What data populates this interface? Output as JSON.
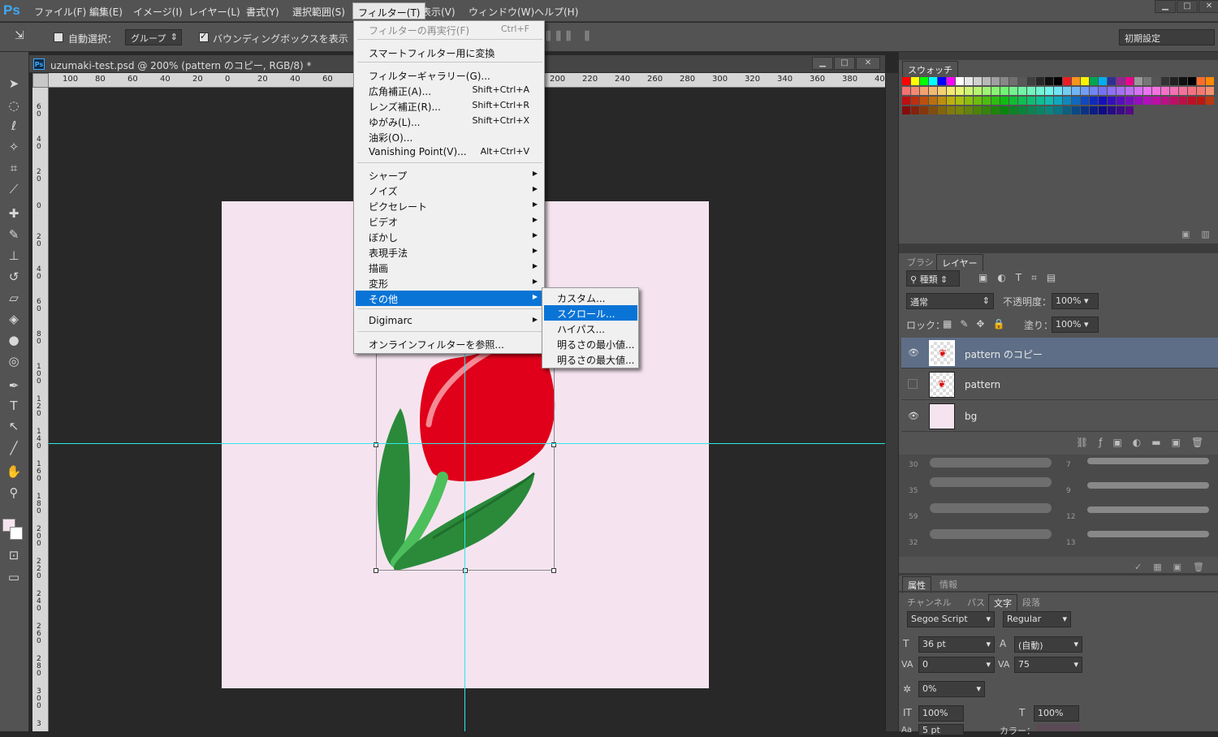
{
  "menubar": {
    "logo": "Ps",
    "items": [
      "ファイル(F)",
      "編集(E)",
      "イメージ(I)",
      "レイヤー(L)",
      "書式(Y)",
      "選択範囲(S)",
      "フィルター(T)",
      "表示(V)",
      "ウィンドウ(W)",
      "ヘルプ(H)"
    ]
  },
  "options": {
    "auto_select": "自動選択：",
    "group": "グループ",
    "bbox": "バウンディングボックスを表示",
    "workspace": "初期設定"
  },
  "document": {
    "tab_title": "uzumaki-test.psd @ 200% (pattern のコピー, RGB/8) *",
    "ruler_h": [
      "100",
      "80",
      "60",
      "40",
      "20",
      "0",
      "20",
      "40",
      "60",
      "200",
      "220",
      "240",
      "260",
      "280",
      "300",
      "320",
      "340",
      "360",
      "380",
      "40"
    ],
    "ruler_v": [
      "6\n0",
      "4\n0",
      "2\n0",
      "0",
      "2\n0",
      "4\n0",
      "6\n0",
      "8\n0",
      "1\n0\n0",
      "1\n2\n0",
      "1\n4\n0",
      "1\n6\n0",
      "1\n8\n0",
      "2\n0\n0",
      "2\n2\n0",
      "2\n4\n0",
      "2\n6\n0",
      "2\n8\n0",
      "3\n0\n0",
      "3"
    ]
  },
  "filter_menu": {
    "items": [
      {
        "label": "フィルターの再実行(F)",
        "shortcut": "Ctrl+F",
        "disabled": true
      },
      {
        "label": "スマートフィルター用に変換"
      },
      {
        "label": "フィルターギャラリー(G)..."
      },
      {
        "label": "広角補正(A)...",
        "shortcut": "Shift+Ctrl+A"
      },
      {
        "label": "レンズ補正(R)...",
        "shortcut": "Shift+Ctrl+R"
      },
      {
        "label": "ゆがみ(L)...",
        "shortcut": "Shift+Ctrl+X"
      },
      {
        "label": "油彩(O)..."
      },
      {
        "label": "Vanishing Point(V)...",
        "shortcut": "Alt+Ctrl+V"
      },
      {
        "label": "シャープ"
      },
      {
        "label": "ノイズ"
      },
      {
        "label": "ピクセレート"
      },
      {
        "label": "ビデオ"
      },
      {
        "label": "ぼかし"
      },
      {
        "label": "表現手法"
      },
      {
        "label": "描画"
      },
      {
        "label": "変形"
      },
      {
        "label": "その他"
      },
      {
        "label": "Digimarc"
      },
      {
        "label": "オンラインフィルターを参照..."
      }
    ]
  },
  "submenu": {
    "items": [
      "カスタム...",
      "スクロール...",
      "ハイパス...",
      "明るさの最小値...",
      "明るさの最大値..."
    ]
  },
  "swatches_panel": {
    "tab": "スウォッチ"
  },
  "layers_panel": {
    "tabs": [
      "ブラシ",
      "レイヤー"
    ],
    "kind": "種類",
    "blend": "通常",
    "opacity_label": "不透明度：",
    "opacity": "100%",
    "lock_label": "ロック：",
    "fill_label": "塗り：",
    "fill": "100%",
    "layers": [
      {
        "name": "pattern のコピー",
        "visible": true,
        "selected": true
      },
      {
        "name": "pattern",
        "visible": false,
        "selected": false
      },
      {
        "name": "bg",
        "visible": true,
        "selected": false
      }
    ]
  },
  "brush_sizes": [
    "30",
    "35",
    "59",
    "32",
    "7",
    "9",
    "12",
    "13"
  ],
  "props_panel": {
    "tabs": [
      "属性",
      "情報"
    ]
  },
  "char_panel": {
    "tabs": [
      "チャンネル",
      "パス",
      "文字",
      "段落"
    ],
    "font": "Segoe Script",
    "style": "Regular",
    "size": "36 pt",
    "leading": "(自動)",
    "kerning": "0",
    "tracking": "75",
    "scale_pct": "0%",
    "vscale": "100%",
    "hscale": "100%",
    "baseline": "5 pt",
    "color_label": "カラー："
  }
}
